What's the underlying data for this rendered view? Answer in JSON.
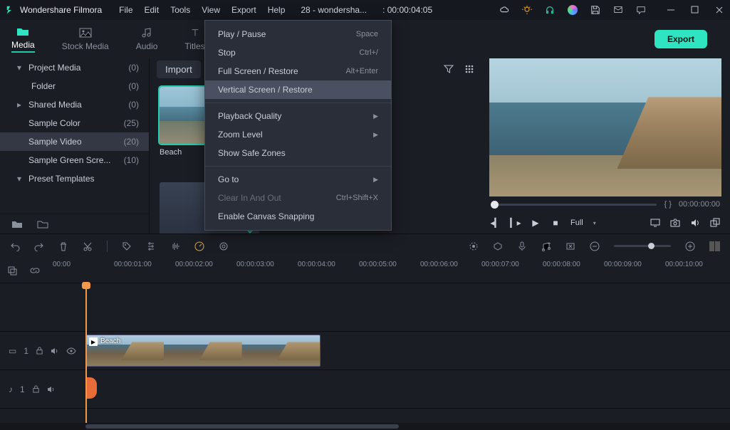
{
  "app": {
    "title": "Wondershare Filmora"
  },
  "menubar": [
    "File",
    "Edit",
    "Tools",
    "View",
    "Export",
    "Help"
  ],
  "project_tab": "28 - wondersha...",
  "project_time": ": 00:00:04:05",
  "toptabs": [
    {
      "label": "Media",
      "active": true
    },
    {
      "label": "Stock Media"
    },
    {
      "label": "Audio"
    },
    {
      "label": "Titles"
    }
  ],
  "export_label": "Export",
  "sidebar": {
    "items": [
      {
        "caret": "▾",
        "label": "Project Media",
        "count": "(0)"
      },
      {
        "caret": "",
        "label": "Folder",
        "count": "(0)",
        "child": true
      },
      {
        "caret": "▸",
        "label": "Shared Media",
        "count": "(0)"
      },
      {
        "caret": "",
        "label": "Sample Color",
        "count": "(25)"
      },
      {
        "caret": "",
        "label": "Sample Video",
        "count": "(20)",
        "selected": true
      },
      {
        "caret": "",
        "label": "Sample Green Scre...",
        "count": "(10)"
      },
      {
        "caret": "▾",
        "label": "Preset Templates",
        "count": ""
      }
    ]
  },
  "browser": {
    "import": "Import",
    "thumbs": [
      {
        "caption": "Beach",
        "style": "beach",
        "selected": true
      },
      {
        "caption": "",
        "style": "dark"
      },
      {
        "caption": "",
        "style": "plane"
      }
    ]
  },
  "preview": {
    "markers": "{   }",
    "time": "00:00:00:00",
    "fit": "Full"
  },
  "dropdown": {
    "groups": [
      [
        {
          "label": "Play / Pause",
          "shortcut": "Space"
        },
        {
          "label": "Stop",
          "shortcut": "Ctrl+/"
        },
        {
          "label": "Full Screen / Restore",
          "shortcut": "Alt+Enter"
        },
        {
          "label": "Vertical Screen / Restore",
          "hover": true
        }
      ],
      [
        {
          "label": "Playback Quality",
          "submenu": true
        },
        {
          "label": "Zoom Level",
          "submenu": true
        },
        {
          "label": "Show Safe Zones"
        }
      ],
      [
        {
          "label": "Go to",
          "submenu": true
        },
        {
          "label": "Clear In And Out",
          "shortcut": "Ctrl+Shift+X",
          "disabled": true
        },
        {
          "label": "Enable Canvas Snapping"
        }
      ]
    ]
  },
  "ruler": [
    "00:00",
    "00:00:01:00",
    "00:00:02:00",
    "00:00:03:00",
    "00:00:04:00",
    "00:00:05:00",
    "00:00:06:00",
    "00:00:07:00",
    "00:00:08:00",
    "00:00:09:00",
    "00:00:10:00"
  ],
  "tracks": {
    "video": {
      "id": "1",
      "clip_label": "Beach"
    },
    "audio": {
      "id": "1"
    }
  }
}
